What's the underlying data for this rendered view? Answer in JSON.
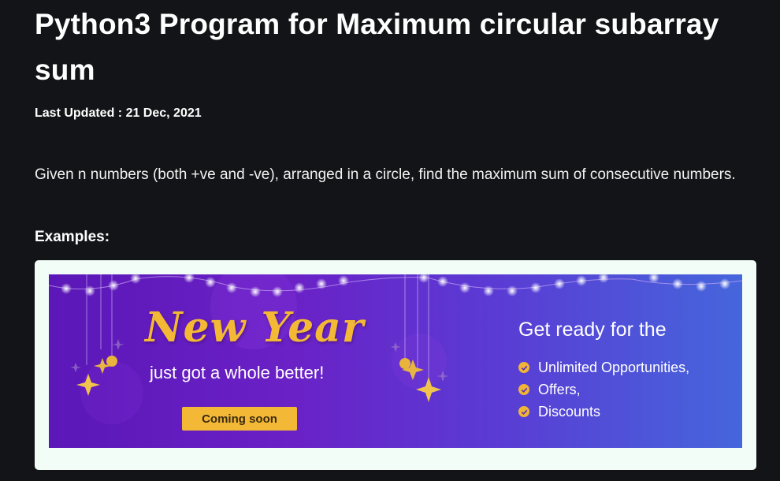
{
  "article": {
    "title": "Python3 Program for Maximum circular subarray sum",
    "last_updated": "Last Updated : 21 Dec, 2021",
    "description": "Given n numbers (both +ve and -ve), arranged in a circle, find the maximum sum of consecutive numbers.",
    "examples_heading": "Examples:"
  },
  "ad_banner": {
    "headline": "New Year",
    "tagline": "just got a whole better!",
    "cta_label": "Coming soon",
    "heading": "Get ready for the",
    "features": [
      "Unlimited Opportunities,",
      "Offers,",
      "Discounts"
    ],
    "colors": {
      "accent": "#f2b836",
      "gradient_start": "#5b17b7",
      "gradient_end": "#4566dc",
      "frame": "#f1fdf6"
    }
  },
  "colors": {
    "background": "#131417",
    "text": "#ffffff"
  }
}
